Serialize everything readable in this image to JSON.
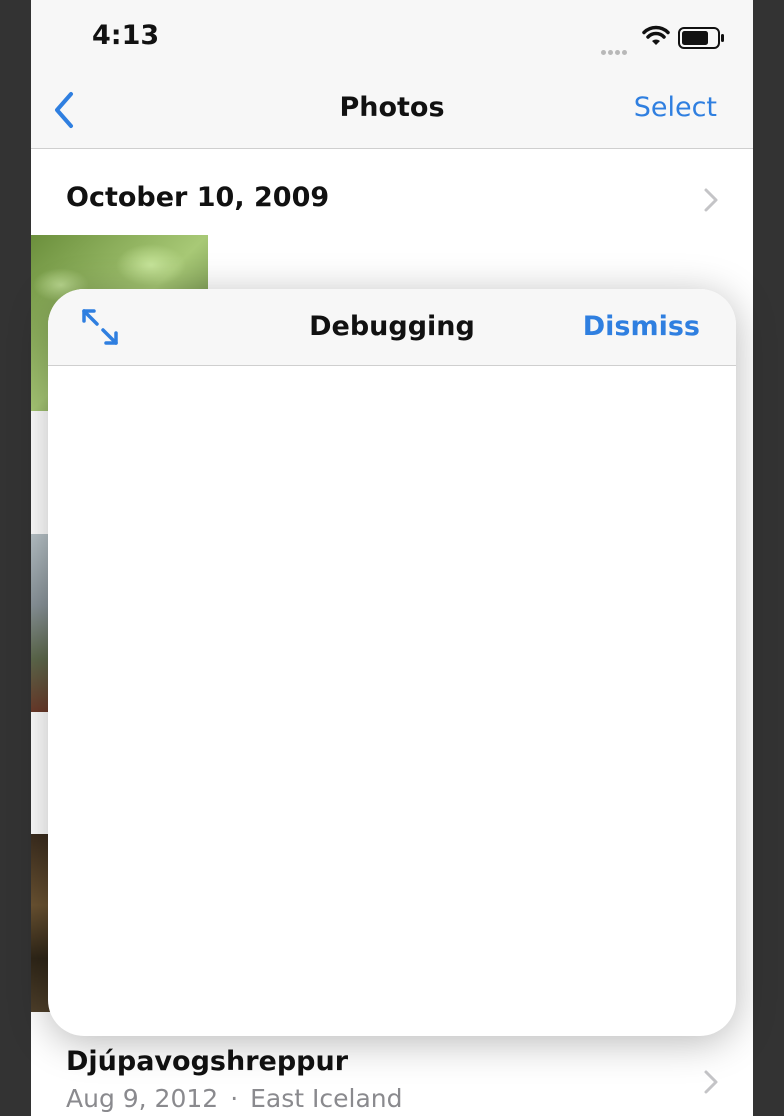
{
  "status_bar": {
    "time": "4:13"
  },
  "nav": {
    "title": "Photos",
    "select_label": "Select"
  },
  "section": {
    "date": "October 10, 2009"
  },
  "place": {
    "title": "Djúpavogshreppur",
    "date": "Aug 9, 2012",
    "separator": "·",
    "region": "East Iceland"
  },
  "debug_sheet": {
    "title": "Debugging",
    "dismiss_label": "Dismiss"
  },
  "colors": {
    "accent": "#2f7fe0",
    "chevron": "#c4c4c7",
    "secondary_text": "#8a8a8e"
  },
  "icons": [
    "back-chevron-icon",
    "expand-icon",
    "chevron-right-icon",
    "wifi-icon",
    "battery-icon",
    "signal-icon"
  ]
}
